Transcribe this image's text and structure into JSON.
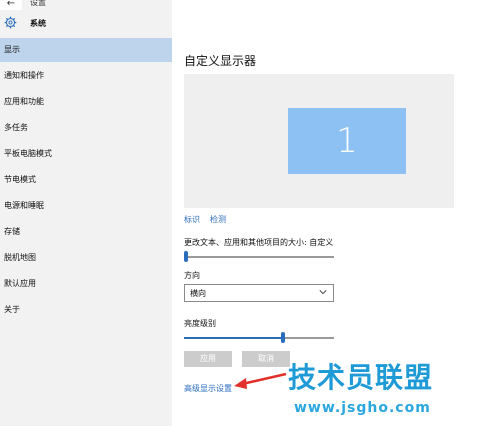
{
  "window": {
    "back_glyph": "←",
    "title": "设置"
  },
  "sidebar": {
    "section_title": "系统",
    "items": [
      {
        "label": "显示",
        "active": true
      },
      {
        "label": "通知和操作"
      },
      {
        "label": "应用和功能"
      },
      {
        "label": "多任务"
      },
      {
        "label": "平板电脑模式"
      },
      {
        "label": "节电模式"
      },
      {
        "label": "电源和睡眠"
      },
      {
        "label": "存储"
      },
      {
        "label": "脱机地图"
      },
      {
        "label": "默认应用"
      },
      {
        "label": "关于"
      }
    ]
  },
  "main": {
    "title": "自定义显示器",
    "monitor_number": "1",
    "identify_link": "标识",
    "detect_link": "检测",
    "scale_label": "更改文本、应用和其他项目的大小: 自定义",
    "orientation_label": "方向",
    "orientation_value": "横向",
    "brightness_label": "亮度级别",
    "brightness_level": 0.66,
    "scale_level": 0.0,
    "apply_button": "应用",
    "cancel_button": "取消",
    "advanced_link": "高级显示设置"
  },
  "watermark": {
    "text": "技术员联盟",
    "url": "www.jsgho.com"
  },
  "colors": {
    "accent": "#2a6dbd",
    "active_nav": "#bed4ec",
    "monitor": "#8ec1f3",
    "watermark": "#1e9bd7",
    "arrow": "#e0312a"
  },
  "icons": {
    "section": "gear-icon",
    "dropdown": "chevron-down-icon",
    "back": "back-arrow-icon"
  }
}
